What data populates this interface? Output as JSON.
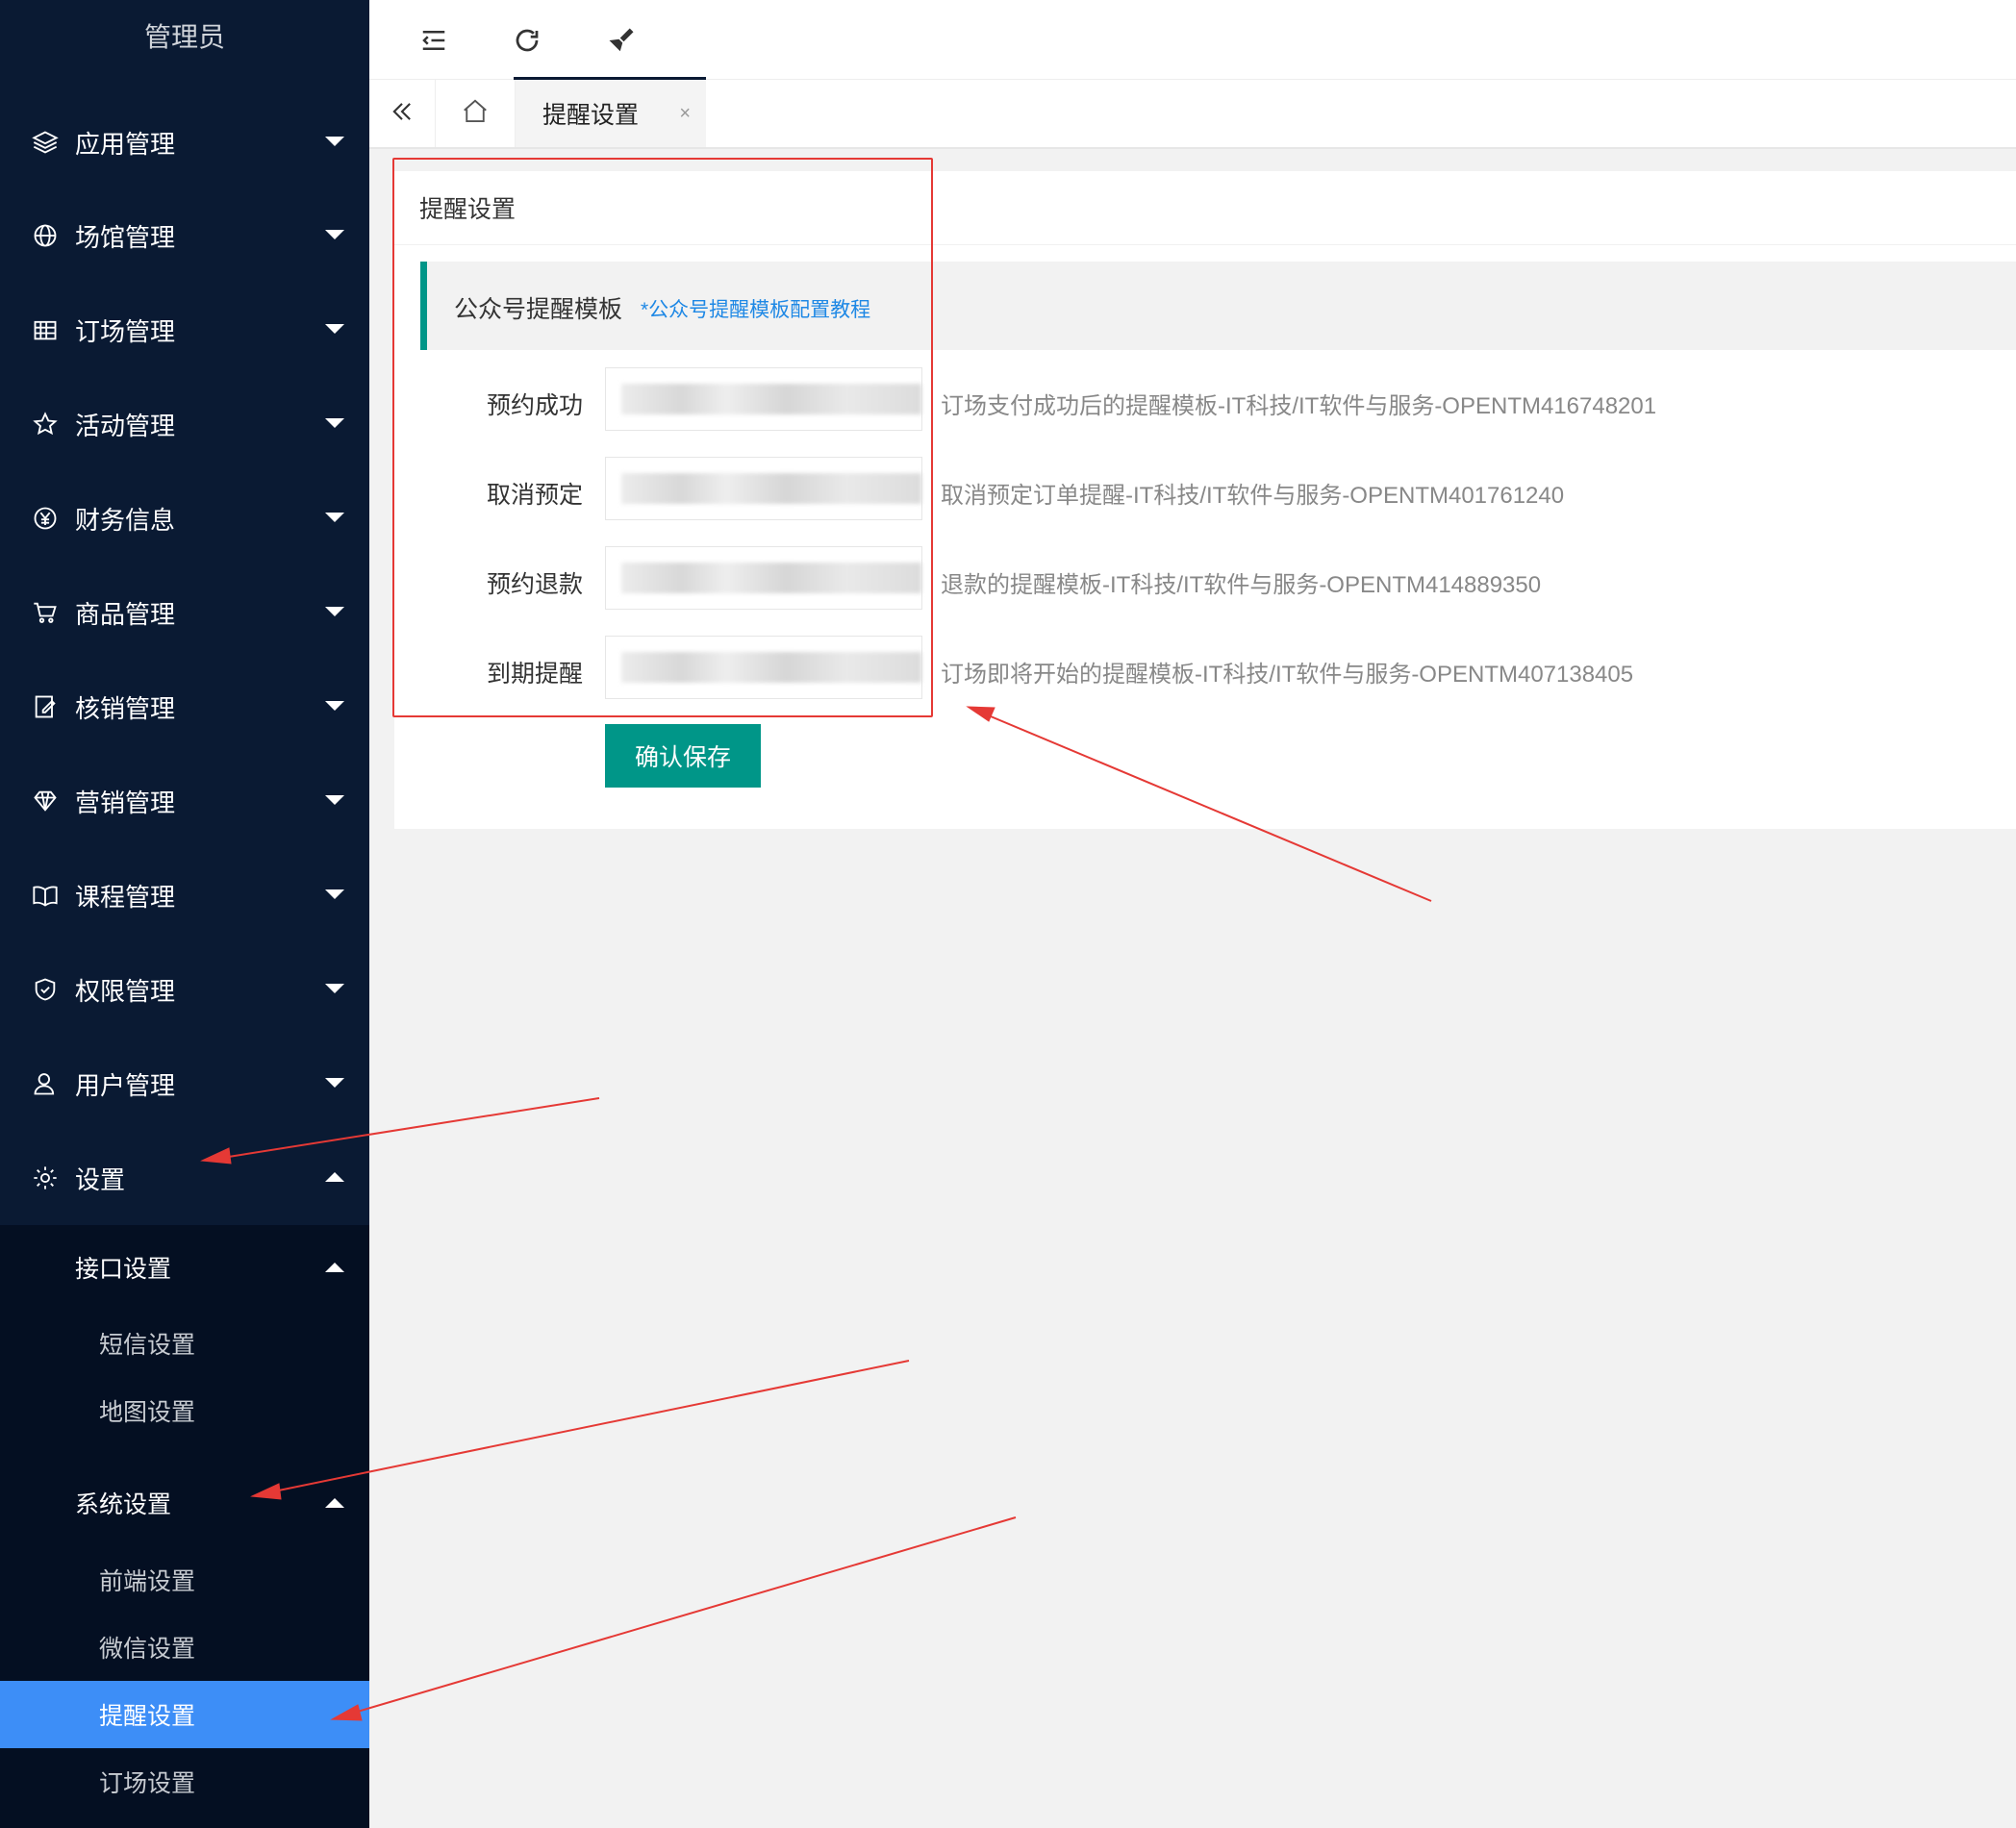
{
  "brand": {
    "title": "管理员"
  },
  "sidebar": {
    "items": [
      {
        "label": "应用管理",
        "icon": "layers-icon"
      },
      {
        "label": "场馆管理",
        "icon": "globe-icon"
      },
      {
        "label": "订场管理",
        "icon": "calendar-icon"
      },
      {
        "label": "活动管理",
        "icon": "star-icon"
      },
      {
        "label": "财务信息",
        "icon": "yen-icon"
      },
      {
        "label": "商品管理",
        "icon": "cart-icon"
      },
      {
        "label": "核销管理",
        "icon": "edit-icon"
      },
      {
        "label": "营销管理",
        "icon": "diamond-icon"
      },
      {
        "label": "课程管理",
        "icon": "book-icon"
      },
      {
        "label": "权限管理",
        "icon": "shield-icon"
      },
      {
        "label": "用户管理",
        "icon": "user-icon"
      },
      {
        "label": "设置",
        "icon": "gear-icon"
      }
    ],
    "groups": [
      {
        "label": "接口设置",
        "children": [
          "短信设置",
          "地图设置"
        ]
      },
      {
        "label": "系统设置",
        "children": [
          "前端设置",
          "微信设置",
          "提醒设置",
          "订场设置"
        ]
      }
    ],
    "active_item": "提醒设置"
  },
  "topbar": {
    "icons": [
      "menu-fold-icon",
      "refresh-icon",
      "brush-icon"
    ]
  },
  "tabs": {
    "active_label": "提醒设置",
    "close_glyph": "×"
  },
  "card": {
    "title": "提醒设置",
    "notice_title": "公众号提醒模板",
    "notice_link": "*公众号提醒模板配置教程",
    "fields": [
      {
        "label": "预约成功",
        "value": "",
        "hint": "订场支付成功后的提醒模板-IT科技/IT软件与服务-OPENTM416748201"
      },
      {
        "label": "取消预定",
        "value": "",
        "hint": "取消预定订单提醒-IT科技/IT软件与服务-OPENTM401761240"
      },
      {
        "label": "预约退款",
        "value": "",
        "hint": "退款的提醒模板-IT科技/IT软件与服务-OPENTM414889350"
      },
      {
        "label": "到期提醒",
        "value": "",
        "hint": "订场即将开始的提醒模板-IT科技/IT软件与服务-OPENTM407138405"
      }
    ],
    "save_label": "确认保存"
  },
  "colors": {
    "sidebar_bg": "#0a1a33",
    "submenu_bg": "#040f22",
    "active_bg": "#3d8ef7",
    "primary": "#009688",
    "link": "#1e88e5",
    "annotation": "#e53935"
  }
}
